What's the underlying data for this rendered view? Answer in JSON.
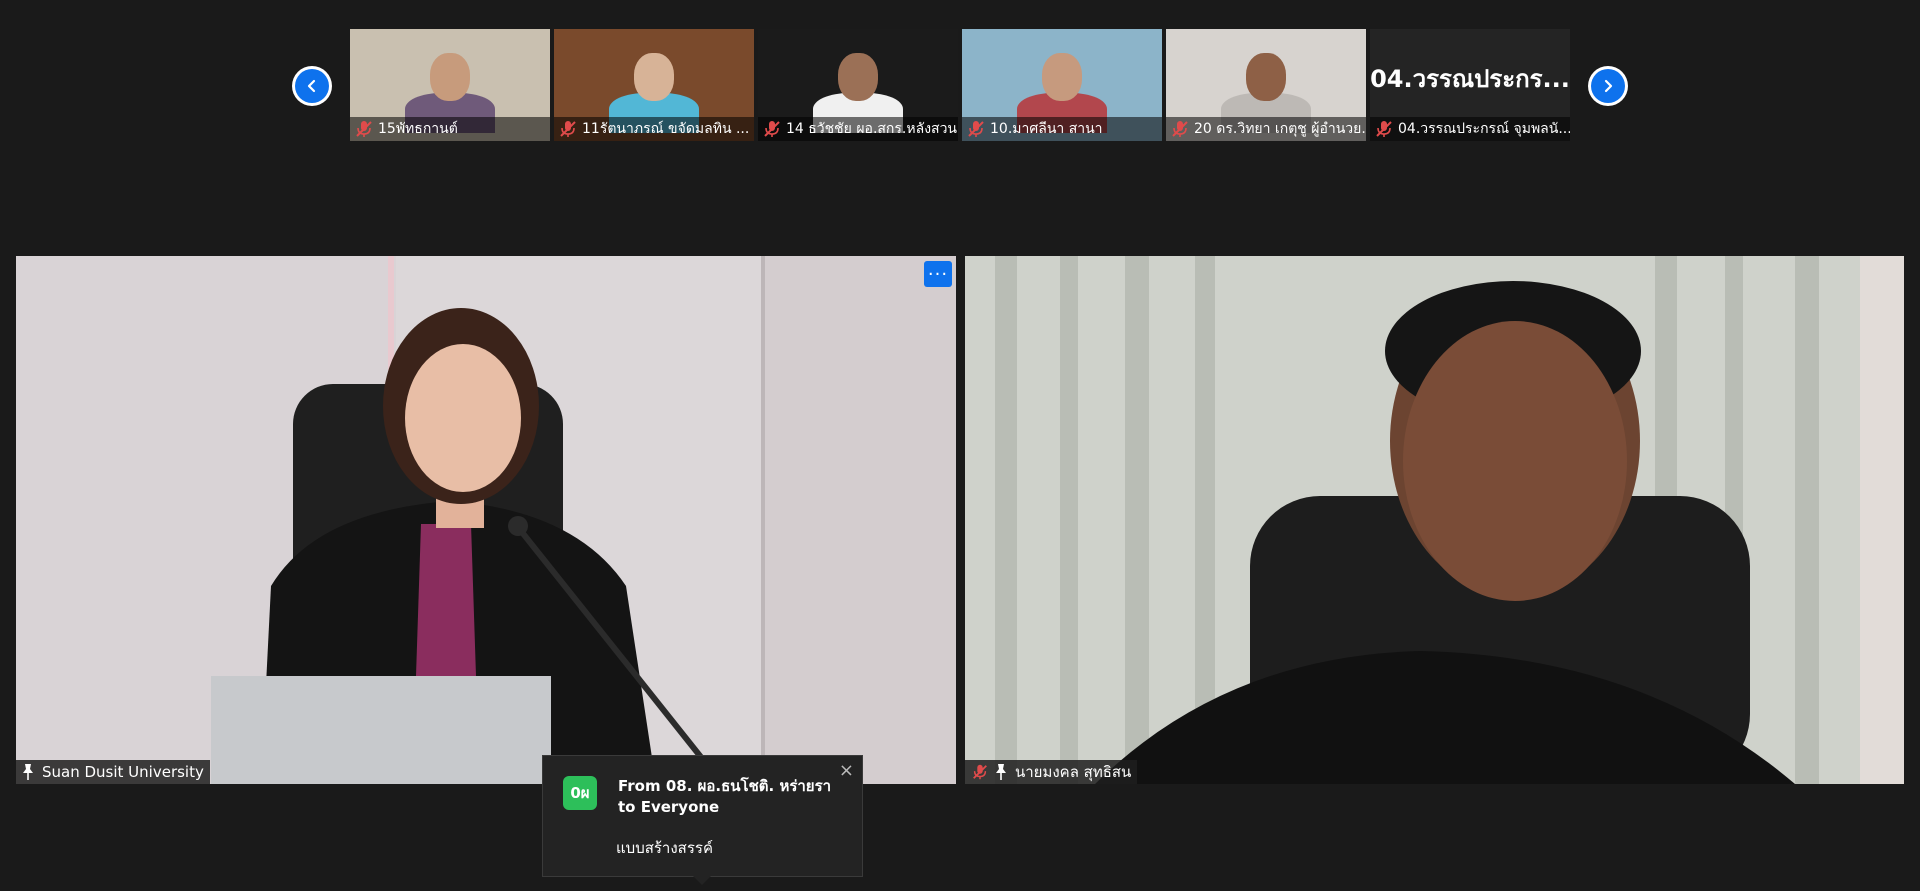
{
  "strip": {
    "prev_icon": "chevron-left-icon",
    "next_icon": "chevron-right-icon",
    "thumbnails": [
      {
        "name": "15พัทธกานต์",
        "muted": true,
        "bg": "#c9c0b0",
        "skin": "#c79b7c",
        "shirt": "#6f5a7a"
      },
      {
        "name": "11รัตนาภรณ์  ขจัดมลทิน ...",
        "muted": true,
        "bg": "#7a4a2c",
        "skin": "#d7b397",
        "shirt": "#52b7d6"
      },
      {
        "name": "14 ธวัชชัย ผอ.สกร.หลังสวน",
        "muted": true,
        "bg": "#1b1b1b",
        "skin": "#9b7056",
        "shirt": "#f0f0f0"
      },
      {
        "name": "10.มาศลีนา สานา",
        "muted": true,
        "bg": "#8cb4c9",
        "skin": "#c69a7e",
        "shirt": "#b2474d"
      },
      {
        "name": "20 ดร.วิทยา เกตุชู ผู้อำนวย...",
        "muted": true,
        "bg": "#d7d3cf",
        "skin": "#8e6046",
        "shirt": "#bdb9b5"
      },
      {
        "name": "04.วรรณประกรณ์ จุมพลนั...",
        "muted": true,
        "bg": "#242424",
        "big_label": "04.วรรณประกร..."
      }
    ]
  },
  "tiles": {
    "left": {
      "name": "Suan Dusit University",
      "icon": "pin-icon",
      "more_label": "···"
    },
    "right": {
      "name": "นายมงคล สุทธิสน",
      "icon": "pin-icon",
      "muted": true
    }
  },
  "chat_popup": {
    "avatar_text": "0ผ",
    "avatar_color": "#2dbf5a",
    "header": "From 08. ผอ.ธนโชติ. หร่ายรา to Everyone",
    "message": "แบบสร้างสรรค์",
    "close_label": "×"
  }
}
